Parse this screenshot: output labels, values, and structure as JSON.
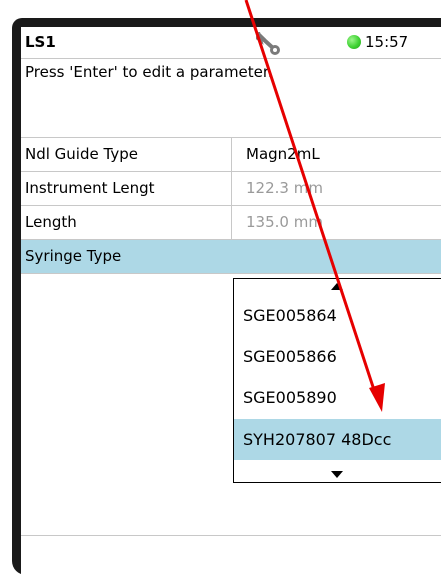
{
  "header": {
    "title": "LS1",
    "time": "15:57",
    "status_icon": "status-dot-icon",
    "status_color": "#3fd233",
    "wrench_icon": "wrench-icon"
  },
  "instruction": "Press 'Enter' to edit a parameter.",
  "parameters": [
    {
      "name": "Ndl Guide Type",
      "value": "Magn2mL"
    },
    {
      "name": "Instrument Lengt",
      "value": "122.3 mm"
    },
    {
      "name": "Length",
      "value": "135.0 mm"
    },
    {
      "name": "Syringe Type",
      "value": ""
    }
  ],
  "dropdown": {
    "options": [
      "SGE005864",
      "SGE005866",
      "SGE005890",
      "SYH207807 48Dcc"
    ],
    "selected_index": 3,
    "scroll_up_icon": "triangle-up-icon",
    "scroll_down_icon": "triangle-down-icon"
  },
  "colors": {
    "selection": "#add8e6",
    "annotation_arrow": "#e60000"
  }
}
